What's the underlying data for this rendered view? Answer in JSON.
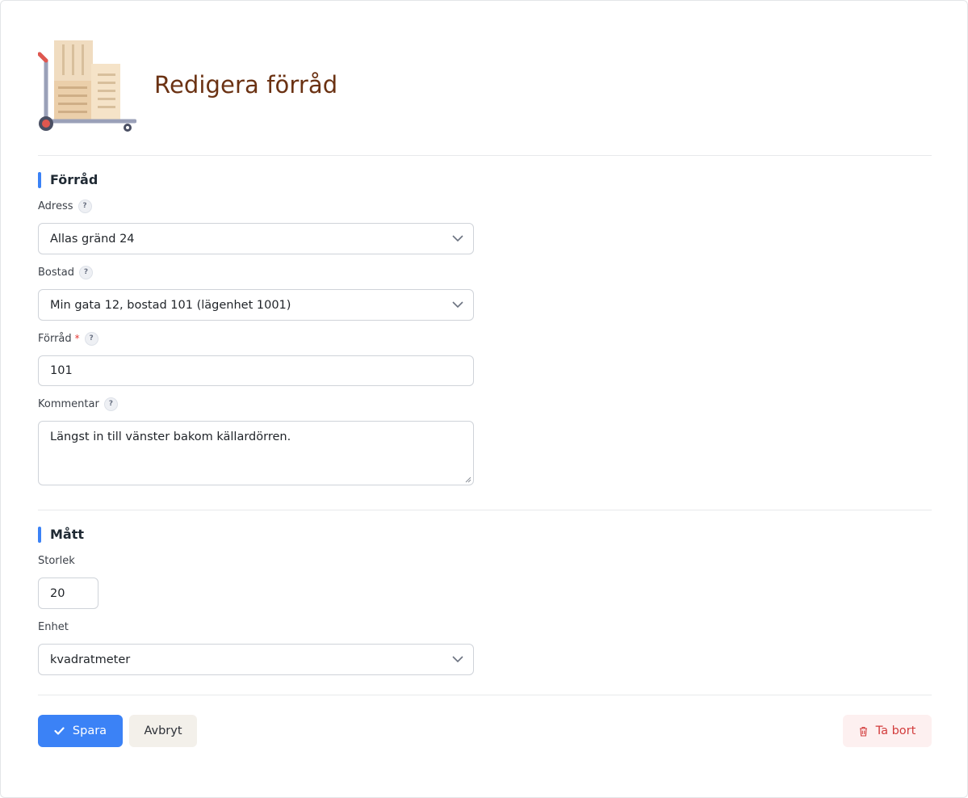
{
  "header": {
    "title": "Redigera förråd"
  },
  "sections": {
    "storage": {
      "title": "Förråd"
    },
    "dimensions": {
      "title": "Mått"
    }
  },
  "fields": {
    "address": {
      "label": "Adress",
      "help": "?",
      "value": "Allas gränd 24"
    },
    "housing": {
      "label": "Bostad",
      "help": "?",
      "value": "Min gata 12, bostad 101 (lägenhet 1001)"
    },
    "storage": {
      "label": "Förråd",
      "required": "*",
      "help": "?",
      "value": "101"
    },
    "comment": {
      "label": "Kommentar",
      "help": "?",
      "value": "Längst in till vänster bakom källardörren."
    },
    "size": {
      "label": "Storlek",
      "value": "20"
    },
    "unit": {
      "label": "Enhet",
      "value": "kvadratmeter"
    }
  },
  "actions": {
    "save_label": "Spara",
    "cancel_label": "Avbryt",
    "delete_label": "Ta bort"
  },
  "colors": {
    "primary": "#3b82f6",
    "title": "#6b3213",
    "danger": "#d23c3c",
    "danger_bg": "#fdf0f0",
    "cancel_bg": "#f3f0ea"
  }
}
